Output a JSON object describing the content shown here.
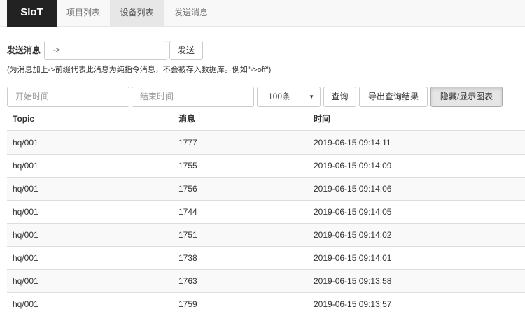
{
  "navbar": {
    "brand": "SIoT",
    "tabs": [
      {
        "label": "项目列表",
        "active": false
      },
      {
        "label": "设备列表",
        "active": true
      },
      {
        "label": "发送消息",
        "active": false
      }
    ]
  },
  "send": {
    "label": "发送消息",
    "input_value": "->",
    "button_label": "发送",
    "hint": "(为消息加上->前缀代表此消息为纯指令消息，不会被存入数据库。例如\"->off\")"
  },
  "filters": {
    "start_placeholder": "开始时间",
    "end_placeholder": "结束时间",
    "limit_selected": "100条",
    "query_label": "查询",
    "export_label": "导出查询结果",
    "toggle_chart_label": "隐藏/显示图表"
  },
  "table": {
    "headers": [
      "Topic",
      "消息",
      "时间"
    ],
    "rows": [
      {
        "topic": "hq/001",
        "message": "1777",
        "time": "2019-06-15 09:14:11"
      },
      {
        "topic": "hq/001",
        "message": "1755",
        "time": "2019-06-15 09:14:09"
      },
      {
        "topic": "hq/001",
        "message": "1756",
        "time": "2019-06-15 09:14:06"
      },
      {
        "topic": "hq/001",
        "message": "1744",
        "time": "2019-06-15 09:14:05"
      },
      {
        "topic": "hq/001",
        "message": "1751",
        "time": "2019-06-15 09:14:02"
      },
      {
        "topic": "hq/001",
        "message": "1738",
        "time": "2019-06-15 09:14:01"
      },
      {
        "topic": "hq/001",
        "message": "1763",
        "time": "2019-06-15 09:13:58"
      },
      {
        "topic": "hq/001",
        "message": "1759",
        "time": "2019-06-15 09:13:57"
      }
    ]
  },
  "icons": {
    "select_caret": "caret-down-icon"
  },
  "colors": {
    "brand_bg": "#222222",
    "active_tab_bg": "#e7e7e7",
    "stripe_bg": "#f9f9f9"
  }
}
